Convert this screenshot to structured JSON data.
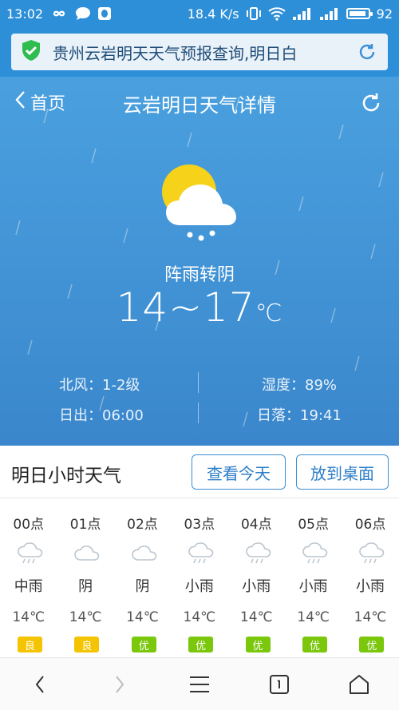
{
  "status_bar": {
    "time": "13:02",
    "speed": "18.4 K/s",
    "battery_level": "92",
    "battery_fill": 0.92
  },
  "browser": {
    "url_text": "贵州云岩明天天气预报查询,明日白"
  },
  "header": {
    "back_label": "首页",
    "title": "云岩明日天气详情"
  },
  "weather": {
    "condition": "阵雨转阴",
    "temp_range": "14~17",
    "unit": "℃",
    "wind": "北风：1-2级",
    "humidity": "湿度：89%",
    "sunrise": "日出：06:00",
    "sunset": "日落：19:41"
  },
  "hourly": {
    "title": "明日小时天气",
    "today_button": "查看今天",
    "desktop_button": "放到桌面",
    "items": [
      {
        "time": "00点",
        "cond": "中雨",
        "temp": "14℃",
        "aqi": "良",
        "icon": "rain-cloud-icon"
      },
      {
        "time": "01点",
        "cond": "阴",
        "temp": "14℃",
        "aqi": "良",
        "icon": "overcast-cloud-icon"
      },
      {
        "time": "02点",
        "cond": "阴",
        "temp": "14℃",
        "aqi": "优",
        "icon": "overcast-cloud-icon"
      },
      {
        "time": "03点",
        "cond": "小雨",
        "temp": "14℃",
        "aqi": "优",
        "icon": "rain-cloud-icon"
      },
      {
        "time": "04点",
        "cond": "小雨",
        "temp": "14℃",
        "aqi": "优",
        "icon": "rain-cloud-icon"
      },
      {
        "time": "05点",
        "cond": "小雨",
        "temp": "14℃",
        "aqi": "优",
        "icon": "rain-cloud-icon"
      },
      {
        "time": "06点",
        "cond": "小雨",
        "temp": "14℃",
        "aqi": "优",
        "icon": "rain-cloud-icon"
      }
    ]
  },
  "colors": {
    "aqi_good": "#f5c400",
    "aqi_excellent": "#7ac70c",
    "accent": "#3b8fd6"
  }
}
